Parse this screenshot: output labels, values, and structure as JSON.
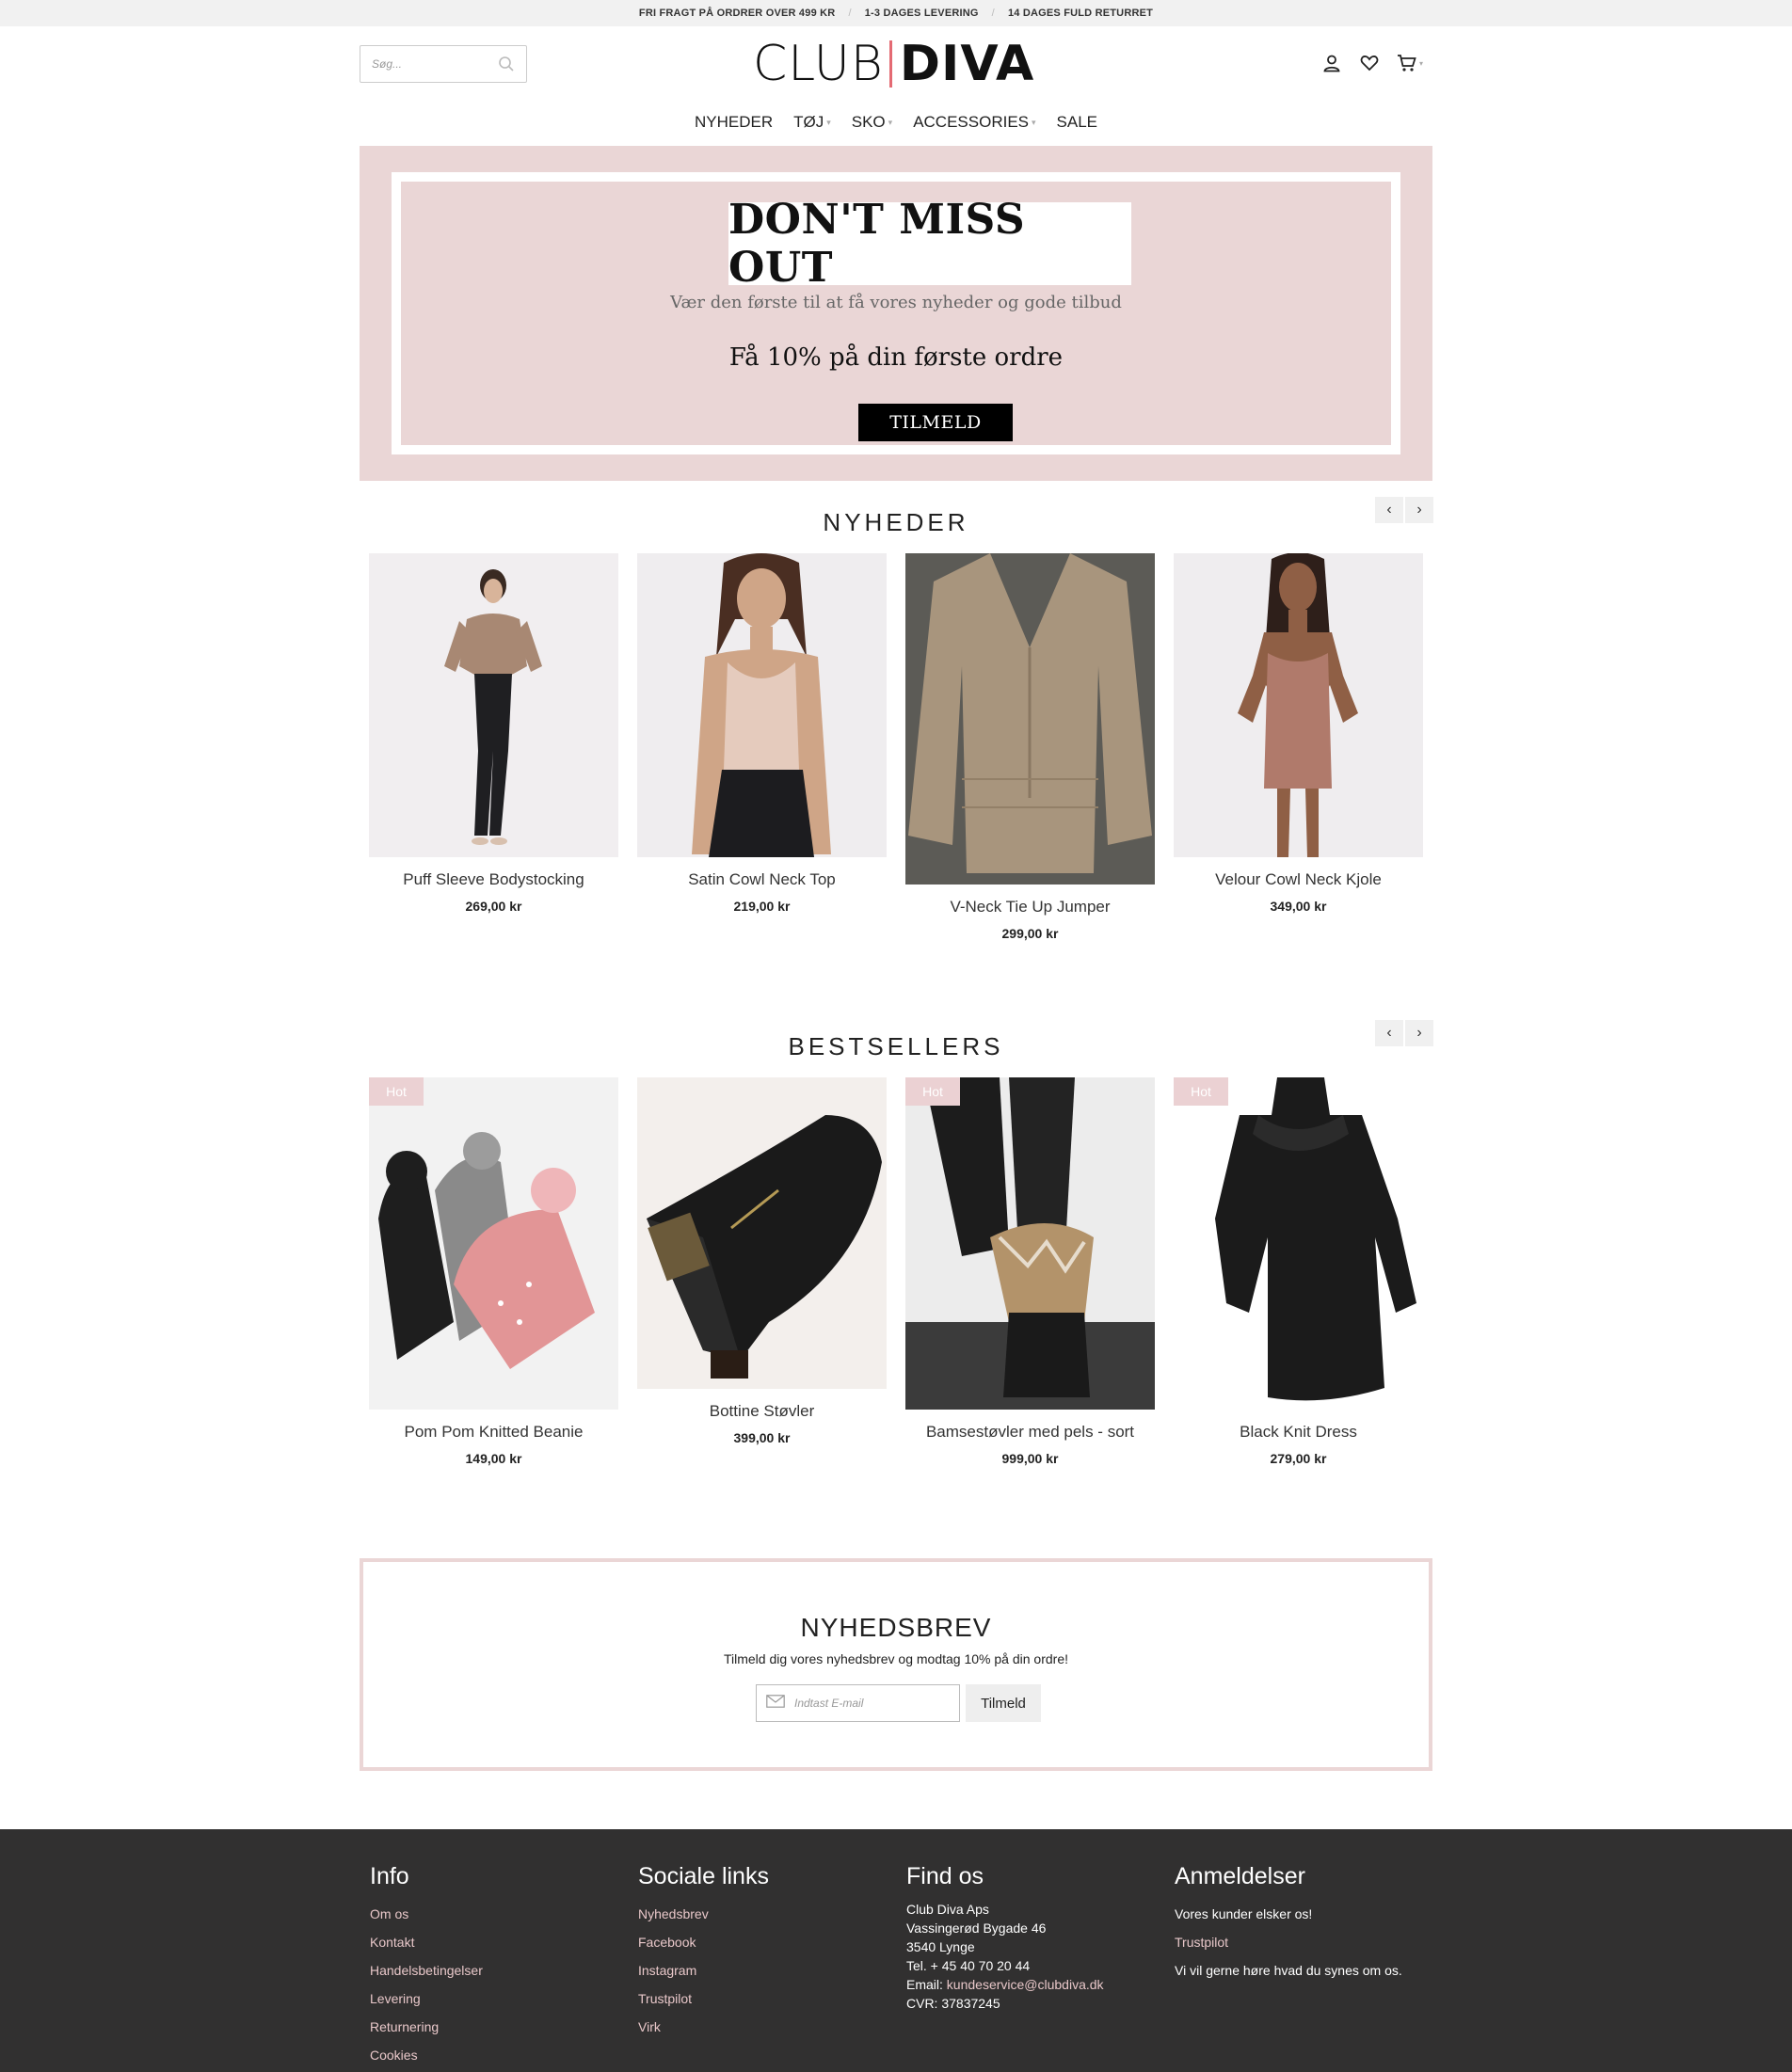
{
  "topbar": {
    "items": [
      "FRI FRAGT PÅ ORDRER OVER 499 KR",
      "1-3 DAGES LEVERING",
      "14 DAGES FULD RETURRET"
    ],
    "separator": "/"
  },
  "header": {
    "search_placeholder": "Søg...",
    "logo_left": "CLUB",
    "logo_right": "DIVA",
    "icons": [
      "user-icon",
      "heart-icon",
      "cart-icon"
    ]
  },
  "nav": {
    "items": [
      {
        "label": "NYHEDER",
        "has_dropdown": false
      },
      {
        "label": "TØJ",
        "has_dropdown": true
      },
      {
        "label": "SKO",
        "has_dropdown": true
      },
      {
        "label": "ACCESSORIES",
        "has_dropdown": true
      },
      {
        "label": "SALE",
        "has_dropdown": false
      }
    ]
  },
  "promo": {
    "title": "DON'T MISS OUT",
    "subtitle": "Vær den første til at få vores nyheder og gode tilbud",
    "offer": "Få 10% på din første ordre",
    "button": "TILMELD",
    "background": "#ead6d6"
  },
  "nyheder": {
    "title": "NYHEDER",
    "prev": "‹",
    "next": "›",
    "products": [
      {
        "name": "Puff Sleeve Bodystocking",
        "price": "269,00 kr"
      },
      {
        "name": "Satin Cowl Neck Top",
        "price": "219,00 kr"
      },
      {
        "name": "V-Neck Tie Up Jumper",
        "price": "299,00 kr"
      },
      {
        "name": "Velour Cowl Neck Kjole",
        "price": "349,00 kr"
      }
    ]
  },
  "bestsellers": {
    "title": "BESTSELLERS",
    "prev": "‹",
    "next": "›",
    "badge": "Hot",
    "products": [
      {
        "name": "Pom Pom Knitted Beanie",
        "price": "149,00 kr",
        "hot": true
      },
      {
        "name": "Bottine Støvler",
        "price": "399,00 kr",
        "hot": false
      },
      {
        "name": "Bamsestøvler med pels - sort",
        "price": "999,00 kr",
        "hot": true
      },
      {
        "name": "Black Knit Dress",
        "price": "279,00 kr",
        "hot": true
      }
    ]
  },
  "newsletter": {
    "title": "NYHEDSBREV",
    "subtitle": "Tilmeld dig vores nyhedsbrev og modtag 10% på din ordre!",
    "email_placeholder": "Indtast E-mail",
    "button": "Tilmeld"
  },
  "footer": {
    "info": {
      "title": "Info",
      "links": [
        "Om os",
        "Kontakt",
        "Handelsbetingelser",
        "Levering",
        "Returnering",
        "Cookies"
      ]
    },
    "social": {
      "title": "Sociale links",
      "links": [
        "Nyhedsbrev",
        "Facebook",
        "Instagram",
        "Trustpilot",
        "Virk"
      ]
    },
    "find": {
      "title": "Find os",
      "company": "Club Diva Aps",
      "street": "Vassingerød Bygade 46",
      "city": "3540 Lynge",
      "phone": "Tel. + 45 40 70 20 44",
      "email_label": "Email: ",
      "email": "kundeservice@clubdiva.dk",
      "cvr": "CVR: 37837245"
    },
    "reviews": {
      "title": "Anmeldelser",
      "line1": "Vores kunder elsker os!",
      "link": "Trustpilot",
      "line2": "Vi vil gerne høre hvad du synes om os."
    }
  },
  "colors": {
    "accent_pink": "#ead6d6",
    "link_pink": "#e8c7c9",
    "footer_bg": "#313030",
    "logo_bar": "#e46a73"
  }
}
